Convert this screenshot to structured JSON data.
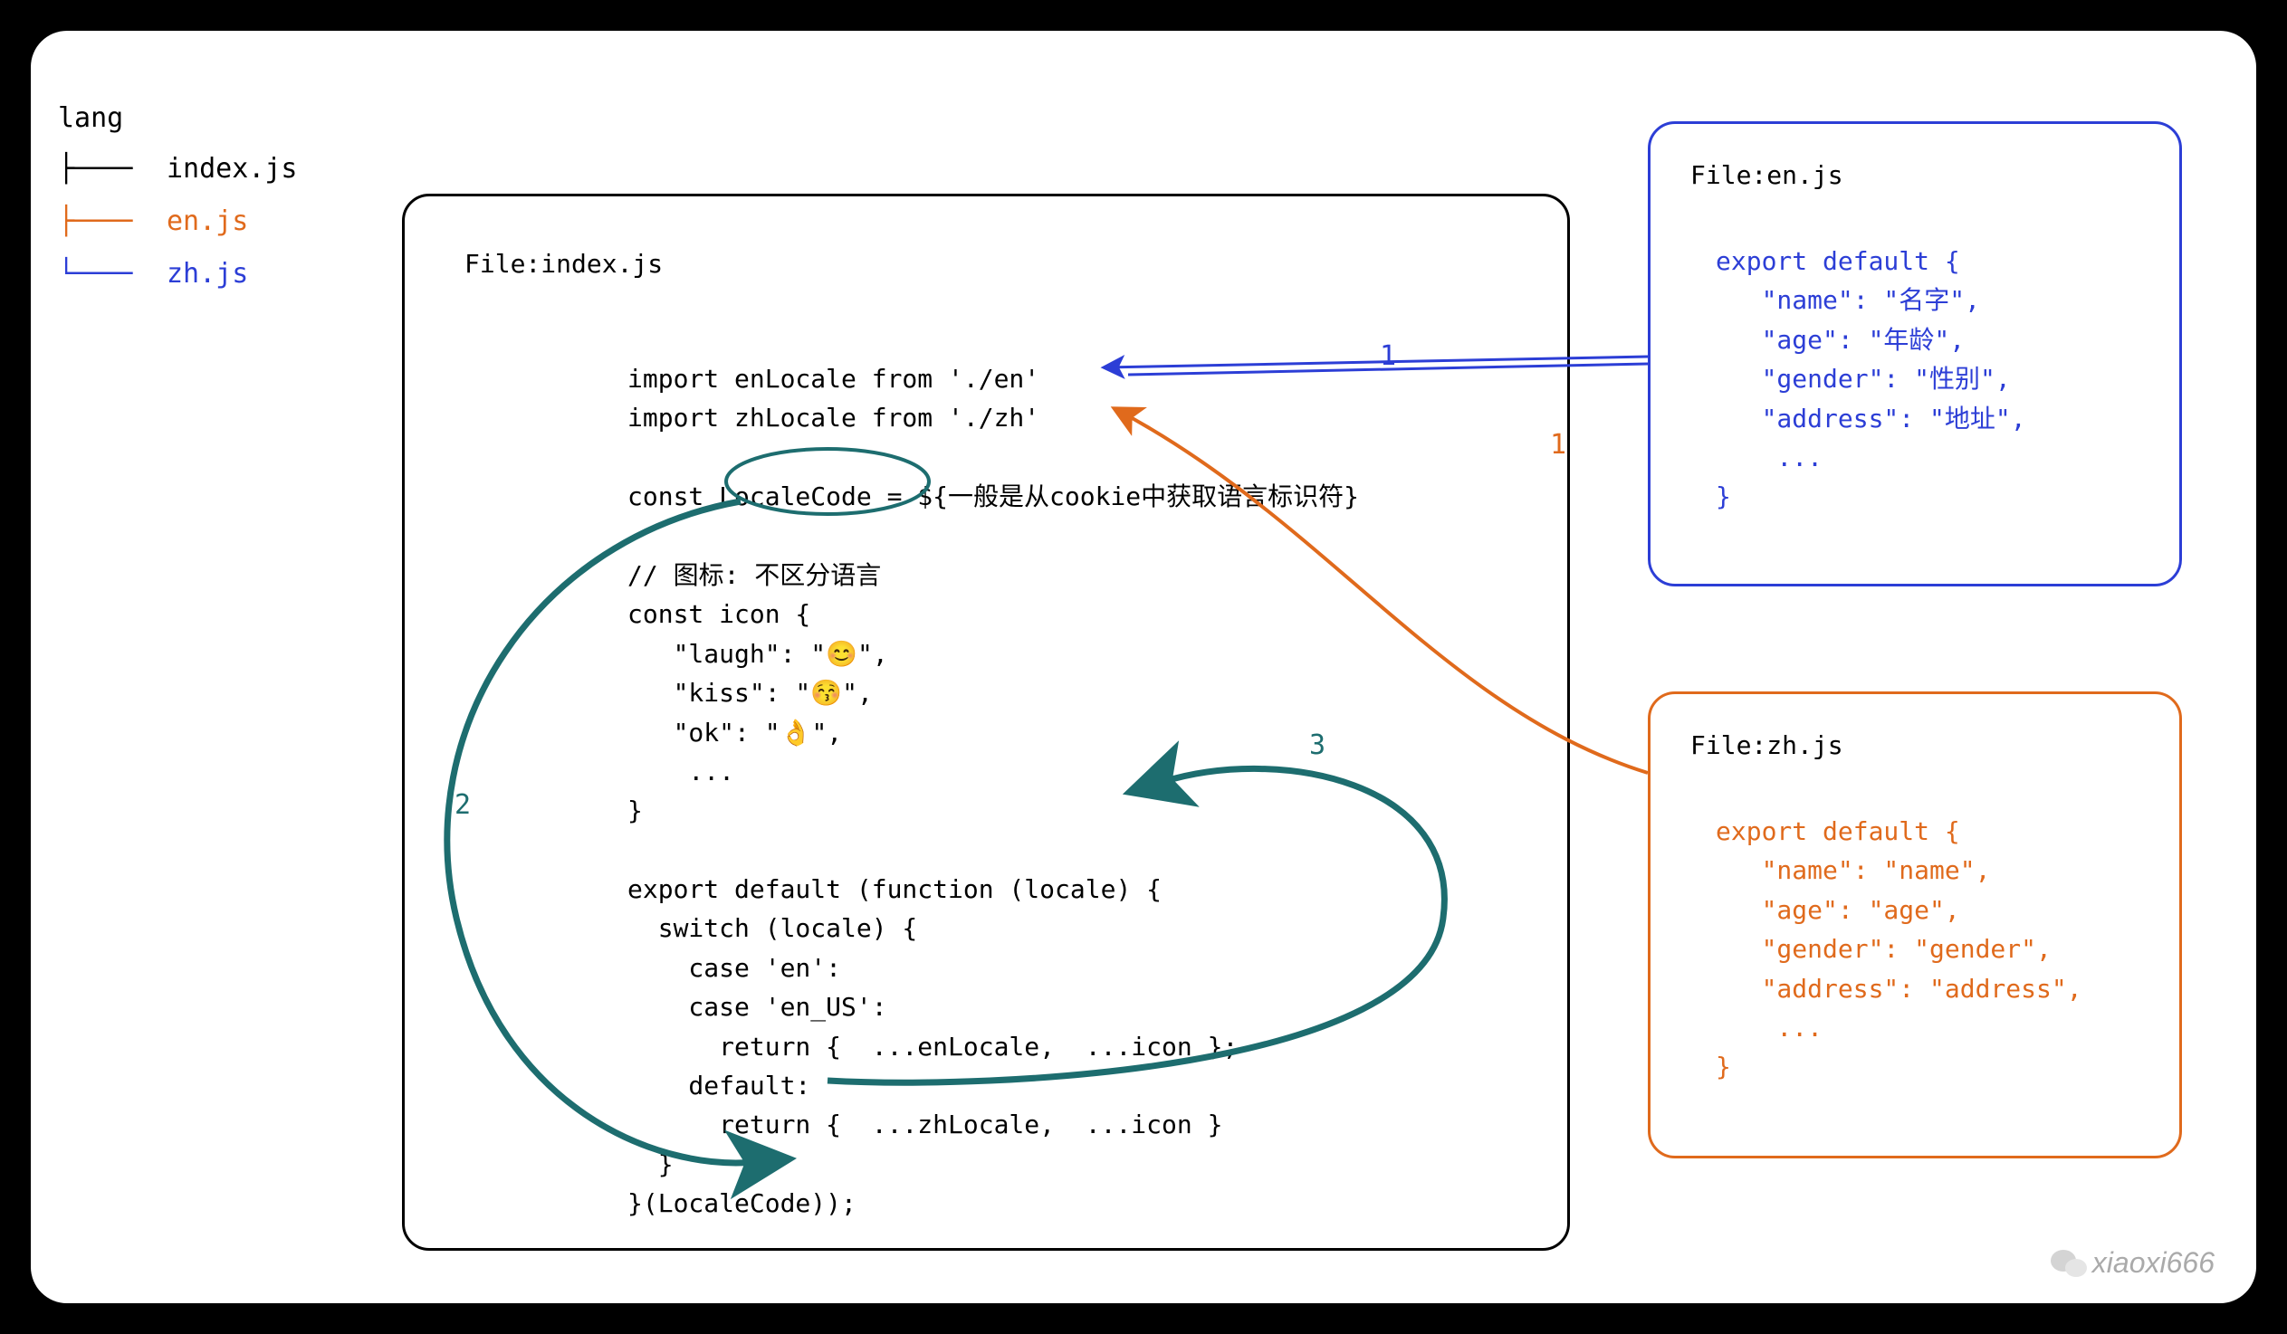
{
  "tree": {
    "root": "lang",
    "items": [
      {
        "branch": "├────",
        "label": "index.js",
        "cls": "idx"
      },
      {
        "branch": "├────",
        "label": "en.js",
        "cls": "en"
      },
      {
        "branch": "└────",
        "label": "zh.js",
        "cls": "zh"
      }
    ]
  },
  "files": {
    "index": {
      "title": "File:index.js",
      "code": "import enLocale from './en'\nimport zhLocale from './zh'\n\nconst LocaleCode = ${一般是从cookie中获取语言标识符}\n\n// 图标: 不区分语言\nconst icon {\n   \"laugh\": \"😊\",\n   \"kiss\": \"😚\",\n   \"ok\": \"👌\",\n    ...\n}\n\nexport default (function (locale) {\n  switch (locale) {\n    case 'en':\n    case 'en_US':\n      return {  ...enLocale,  ...icon };\n    default:\n      return {  ...zhLocale,  ...icon }\n  }\n}(LocaleCode));"
    },
    "en": {
      "title": "File:en.js",
      "code": "export default {\n   \"name\": \"名字\",\n   \"age\": \"年龄\",\n   \"gender\": \"性别\",\n   \"address\": \"地址\",\n    ...\n}"
    },
    "zh": {
      "title": "File:zh.js",
      "code": "export default {\n   \"name\": \"name\",\n   \"age\": \"age\",\n   \"gender\": \"gender\",\n   \"address\": \"address\",\n    ...\n}"
    }
  },
  "arrows": {
    "labels": {
      "en_to_index": "1",
      "zh_to_index": "1",
      "localecode_loop_down": "2",
      "localecode_loop_up": "3"
    }
  },
  "watermark": "xiaoxi666",
  "colors": {
    "black": "#000000",
    "blue": "#2c3ed6",
    "orange": "#e06a1c",
    "teal": "#1d6d6f"
  }
}
